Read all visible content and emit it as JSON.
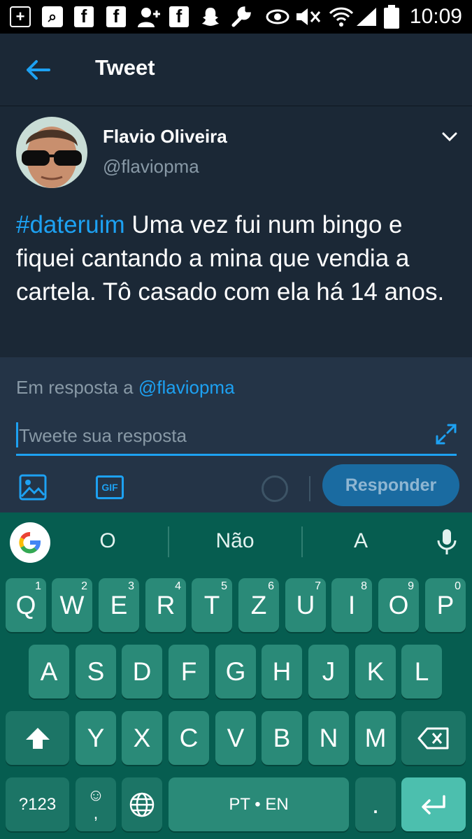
{
  "status_bar": {
    "time": "10:09",
    "icons": [
      "plus-box-icon",
      "search-box-icon",
      "facebook-icon",
      "facebook-icon",
      "add-person-icon",
      "facebook-icon",
      "snapchat-icon",
      "wrench-icon",
      "eye-icon",
      "mute-icon",
      "wifi-icon",
      "signal-icon",
      "battery-icon"
    ]
  },
  "header": {
    "title": "Tweet",
    "back_icon": "arrow-left-icon"
  },
  "tweet": {
    "author_name": "Flavio Oliveira",
    "author_handle": "@flaviopma",
    "hashtag": "#dateruim",
    "text": " Uma vez fui num bingo e fiquei cantando a mina que vendia a cartela. Tô casado com ela há 14 anos."
  },
  "composer": {
    "reply_to_prefix": "Em resposta a ",
    "reply_to_handle": "@flaviopma",
    "placeholder": "Tweete sua resposta",
    "reply_button_label": "Responder"
  },
  "keyboard": {
    "suggestions": [
      "O",
      "Não",
      "A"
    ],
    "row1": [
      {
        "k": "Q",
        "h": "1"
      },
      {
        "k": "W",
        "h": "2"
      },
      {
        "k": "E",
        "h": "3"
      },
      {
        "k": "R",
        "h": "4"
      },
      {
        "k": "T",
        "h": "5"
      },
      {
        "k": "Z",
        "h": "6"
      },
      {
        "k": "U",
        "h": "7"
      },
      {
        "k": "I",
        "h": "8"
      },
      {
        "k": "O",
        "h": "9"
      },
      {
        "k": "P",
        "h": "0"
      }
    ],
    "row2": [
      "A",
      "S",
      "D",
      "F",
      "G",
      "H",
      "J",
      "K",
      "L"
    ],
    "row3": [
      "Y",
      "X",
      "C",
      "V",
      "B",
      "N",
      "M"
    ],
    "symbols_label": "?123",
    "emoji_top": "☺",
    "emoji_bottom": ",",
    "space_label": "PT • EN",
    "period_label": "."
  },
  "colors": {
    "accent": "#1da1f2",
    "background": "#1b2836",
    "composer_bg": "#243447",
    "keyboard_bg": "#065d50",
    "key_bg": "#2a8a78"
  }
}
